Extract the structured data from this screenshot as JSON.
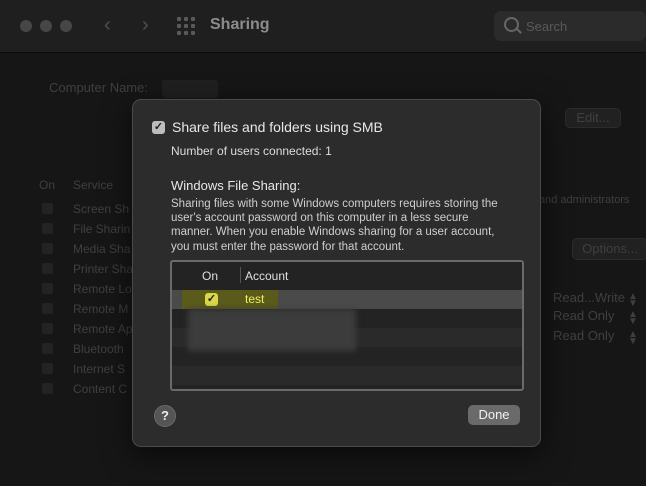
{
  "window": {
    "title": "Sharing",
    "search_placeholder": "Search"
  },
  "background": {
    "computer_name_label": "Computer Name:",
    "edit_button": "Edit...",
    "options_button": "Options...",
    "service_header_on": "On",
    "service_header_service": "Service",
    "services": [
      "Screen Sh",
      "File Sharin",
      "Media Sha",
      "Printer Sha",
      "Remote Lo",
      "Remote M",
      "Remote Ap",
      "Bluetooth",
      "Internet S",
      "Content C"
    ],
    "admins_text": "and administrators",
    "permissions": [
      "Read...Write",
      "Read Only",
      "Read Only"
    ]
  },
  "dialog": {
    "smb_label": "Share files and folders using SMB",
    "smb_checked": true,
    "users_connected": "Number of users connected: 1",
    "windows_sharing_title": "Windows File Sharing:",
    "windows_sharing_desc": "Sharing files with some Windows computers requires storing the user's account password on this computer in a less secure manner. When you enable Windows sharing for a user account, you must enter the password for that account.",
    "table": {
      "col_on": "On",
      "col_account": "Account",
      "rows": [
        {
          "account": "test",
          "on": true
        }
      ]
    },
    "help_label": "?",
    "done_label": "Done"
  }
}
